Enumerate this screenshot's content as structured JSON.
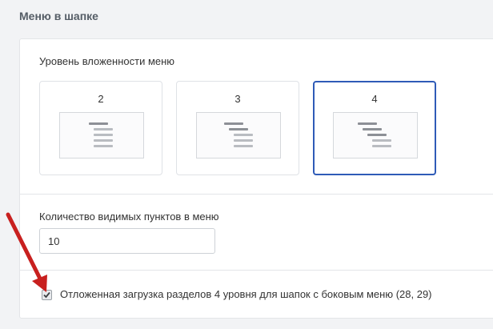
{
  "section": {
    "title": "Меню в шапке"
  },
  "nesting": {
    "label": "Уровень вложенности меню",
    "options": [
      {
        "label": "2",
        "selected": false
      },
      {
        "label": "3",
        "selected": false
      },
      {
        "label": "4",
        "selected": true
      }
    ]
  },
  "visible_items": {
    "label": "Количество видимых пунктов в меню",
    "value": "10"
  },
  "lazy_load": {
    "label": "Отложенная загрузка разделов 4 уровня для шапок с боковым меню (28, 29)",
    "checked": true
  },
  "colors": {
    "accent": "#2f5bb7",
    "annotation_arrow": "#c8201f"
  }
}
